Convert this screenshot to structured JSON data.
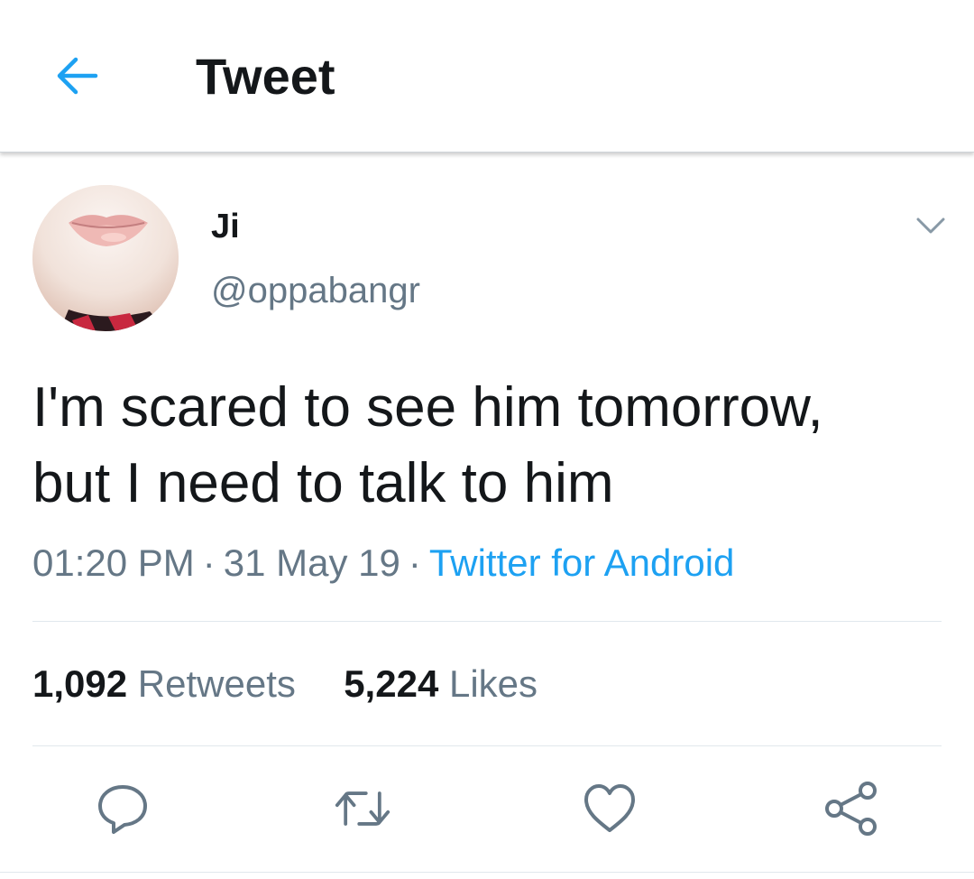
{
  "header": {
    "title": "Tweet",
    "back_icon": "arrow-left-icon"
  },
  "tweet": {
    "author": {
      "display_name": "Ji",
      "handle": "@oppabangr"
    },
    "text": "I'm scared to see him tomorrow,\nbut I need to talk to him",
    "time": "01:20 PM",
    "date": "31 May 19",
    "separator": "·",
    "source": "Twitter for Android",
    "retweets": {
      "count": "1,092",
      "label": "Retweets"
    },
    "likes": {
      "count": "5,224",
      "label": "Likes"
    }
  },
  "actions": [
    "reply-icon",
    "retweet-icon",
    "like-icon",
    "share-icon"
  ],
  "colors": {
    "accent": "#1da1f2",
    "text_primary": "#14171a",
    "text_secondary": "#657786",
    "divider": "#e1e8ed"
  }
}
